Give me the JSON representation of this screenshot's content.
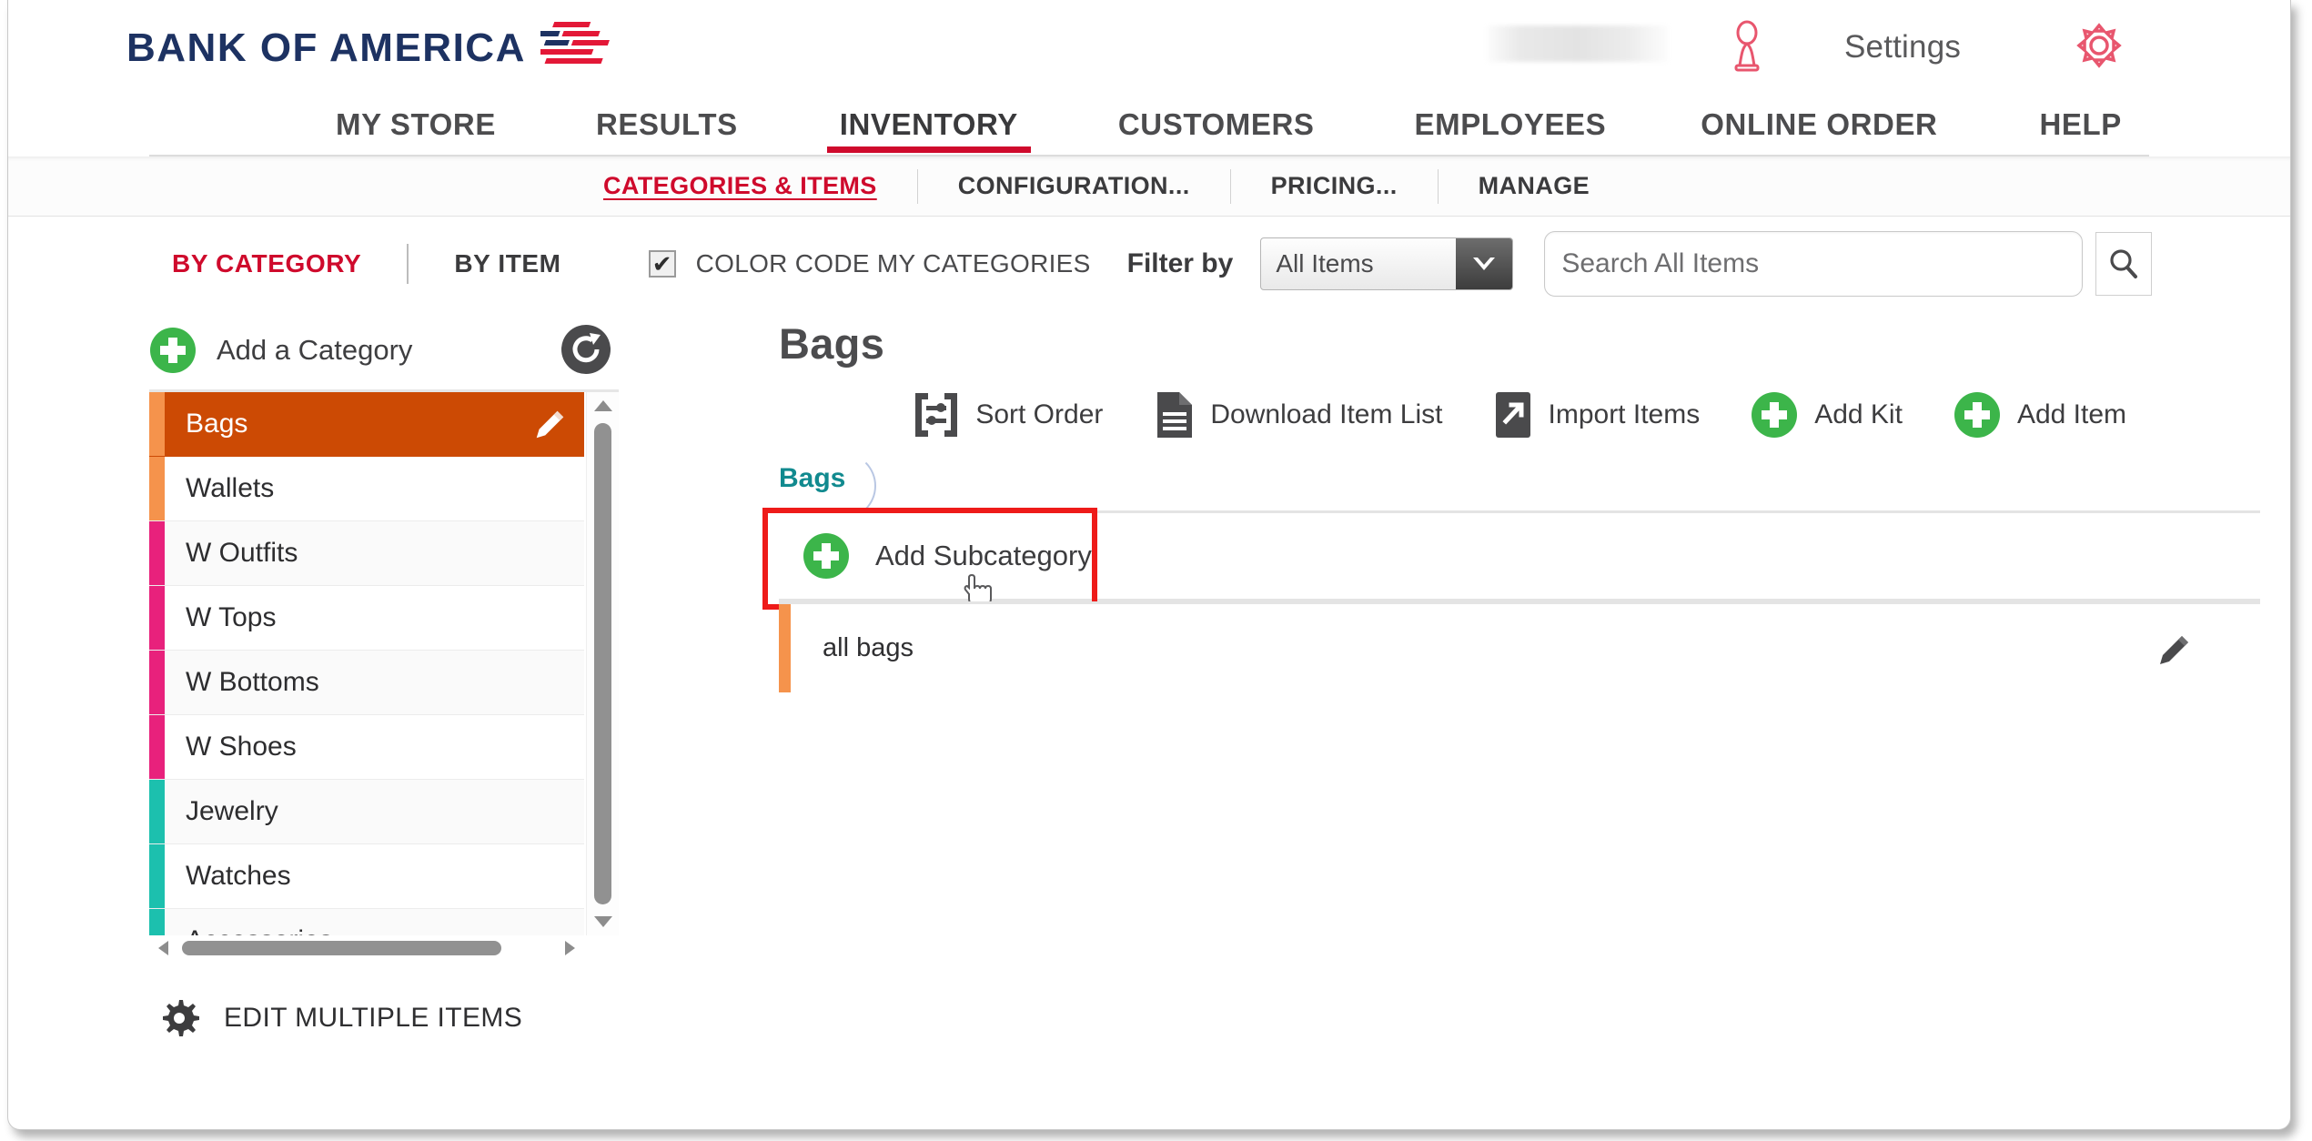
{
  "header": {
    "brand": "BANK OF AMERICA",
    "brand_logo_icon": "bofa-flag-logo",
    "user_icon": "user-profile-icon",
    "settings_label": "Settings",
    "gear_icon": "gear-icon",
    "user_name_redacted": ""
  },
  "main_nav": {
    "items": [
      {
        "label": "MY STORE",
        "active": false
      },
      {
        "label": "RESULTS",
        "active": false
      },
      {
        "label": "INVENTORY",
        "active": true
      },
      {
        "label": "CUSTOMERS",
        "active": false
      },
      {
        "label": "EMPLOYEES",
        "active": false
      },
      {
        "label": "ONLINE ORDER",
        "active": false
      },
      {
        "label": "HELP",
        "active": false
      }
    ]
  },
  "sub_nav": {
    "items": [
      {
        "label": "CATEGORIES & ITEMS",
        "active": true
      },
      {
        "label": "CONFIGURATION...",
        "active": false
      },
      {
        "label": "PRICING...",
        "active": false
      },
      {
        "label": "MANAGE",
        "active": false
      }
    ]
  },
  "filter_bar": {
    "tab_by_category": "BY CATEGORY",
    "tab_by_item": "BY ITEM",
    "color_code_checkbox_checked": true,
    "color_code_check_glyph": "✔",
    "color_code_label": "COLOR CODE MY CATEGORIES",
    "filter_by_label": "Filter by",
    "filter_value": "All Items",
    "filter_options": [
      "All Items"
    ],
    "search_placeholder": "Search All Items",
    "search_value": "",
    "search_icon": "magnifier-icon",
    "dropdown_icon": "chevron-down-icon"
  },
  "sidebar": {
    "add_category_label": "Add a Category",
    "add_category_icon": "plus-circle-icon",
    "refresh_icon": "refresh-icon",
    "edit_multiple_label": "EDIT MULTIPLE ITEMS",
    "edit_multiple_icon": "gear-icon",
    "categories": [
      {
        "label": "Bags",
        "color": "#F5934C",
        "selected": true
      },
      {
        "label": "Wallets",
        "color": "#F5934C",
        "selected": false
      },
      {
        "label": "W Outfits",
        "color": "#E8217C",
        "selected": false
      },
      {
        "label": "W Tops",
        "color": "#E8217C",
        "selected": false
      },
      {
        "label": "W Bottoms",
        "color": "#E8217C",
        "selected": false
      },
      {
        "label": "W Shoes",
        "color": "#E8217C",
        "selected": false
      },
      {
        "label": "Jewelry",
        "color": "#1CC0AE",
        "selected": false
      },
      {
        "label": "Watches",
        "color": "#1CC0AE",
        "selected": false
      },
      {
        "label": "Accessories",
        "color": "#1CC0AE",
        "selected": false
      }
    ]
  },
  "content": {
    "title": "Bags",
    "breadcrumb": "Bags",
    "actions": [
      {
        "label": "Sort Order",
        "icon": "sort-order-icon"
      },
      {
        "label": "Download Item List",
        "icon": "document-download-icon"
      },
      {
        "label": "Import Items",
        "icon": "import-arrow-icon"
      },
      {
        "label": "Add Kit",
        "icon": "plus-circle-icon"
      },
      {
        "label": "Add Item",
        "icon": "plus-circle-icon"
      }
    ],
    "add_subcategory_label": "Add Subcategory",
    "add_subcategory_icon": "plus-circle-icon",
    "subcategories": [
      {
        "label": "all bags",
        "color": "#F5934C",
        "edit_icon": "pencil-icon"
      }
    ]
  },
  "colors": {
    "brand_navy": "#1d3262",
    "brand_red": "#cf0a2c",
    "selected_row": "#cc4a04",
    "highlight_box": "#ee1b19",
    "green": "#3cb54a",
    "teal": "#118a8f"
  }
}
